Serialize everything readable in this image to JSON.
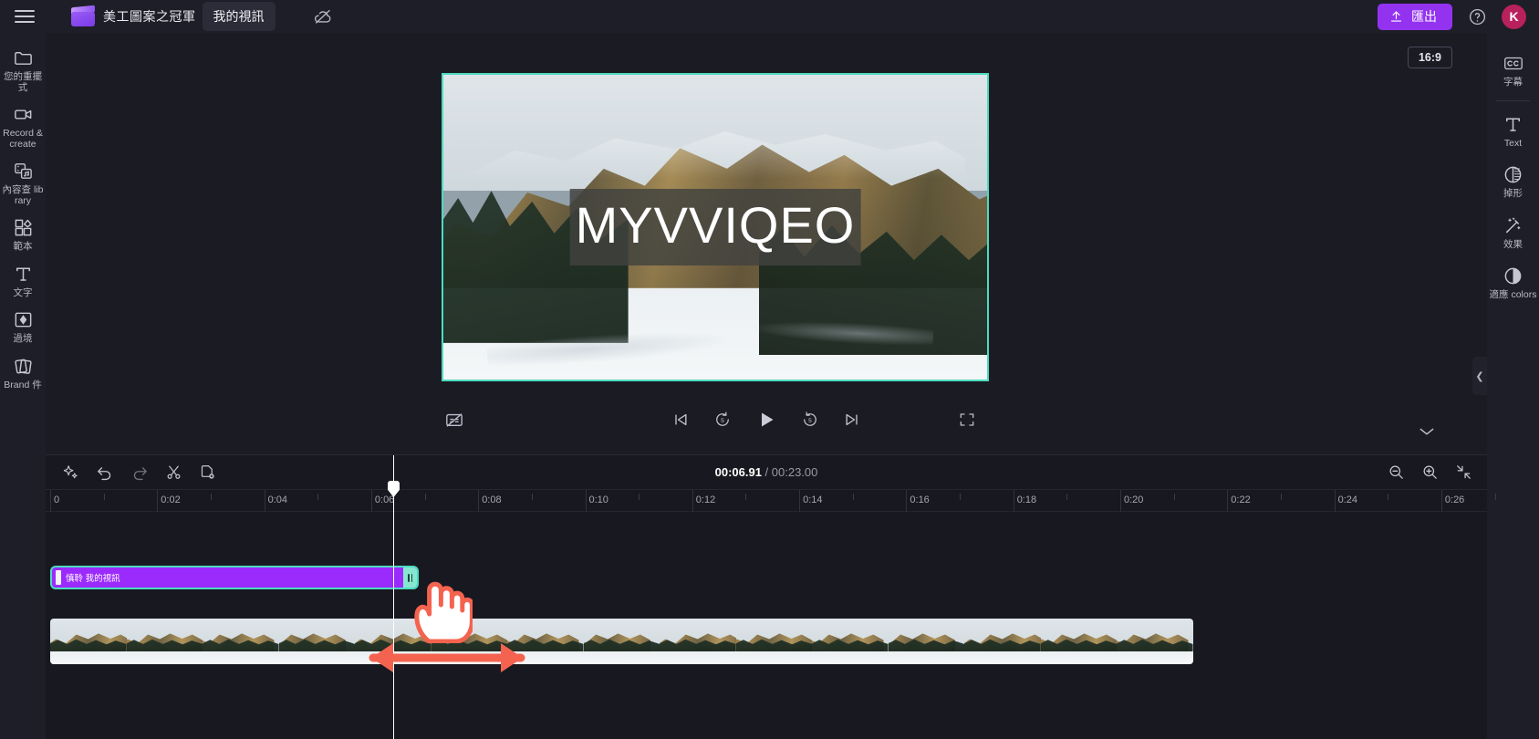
{
  "app": {
    "project_name": "美工圖案之冠軍",
    "title_value": "我的視訊",
    "hamburger_icon": "hamburger-menu-icon",
    "logo_icon": "clipchamp-logo-icon",
    "cloud_icon": "cloud-off-icon"
  },
  "topbar": {
    "export_label": "匯出",
    "export_icon": "upload-icon",
    "help_icon": "help-circle-icon",
    "avatar_initial": "K",
    "accent_color": "#9333f0",
    "avatar_color": "#b8215c"
  },
  "left_rail": {
    "items": [
      {
        "label": "您的重擺式",
        "icon": "folder-icon"
      },
      {
        "label": "Record & create",
        "icon": "video-camera-icon"
      },
      {
        "label": "內容查 library",
        "icon": "content-library-icon"
      },
      {
        "label": "範本",
        "icon": "templates-grid-icon"
      },
      {
        "label": "文字",
        "icon": "text-t-icon"
      },
      {
        "label": "過境",
        "icon": "transitions-icon"
      },
      {
        "label": "Brand 件",
        "icon": "brand-kit-icon"
      }
    ],
    "collapse_icon": "chevron-right-icon"
  },
  "right_rail": {
    "items": [
      {
        "label": "字幕",
        "icon": "closed-captions-icon"
      },
      {
        "label": "Text",
        "icon": "text-t-icon"
      },
      {
        "label": "掉形",
        "icon": "fade-filters-icon"
      },
      {
        "label": "效果",
        "icon": "magic-wand-effects-icon"
      },
      {
        "label": "適應 colors",
        "icon": "adjust-colors-icon"
      }
    ],
    "collapse_icon": "chevron-left-icon"
  },
  "preview": {
    "ratio_badge": "16:9",
    "overlay_text": "MYVVIQEO",
    "frame_border_color": "#4ddbc0",
    "chevron_down_icon": "chevron-down-icon",
    "controls": {
      "captions_icon": "captions-off-icon",
      "skip_start_icon": "skip-to-start-icon",
      "back5_icon": "rewind-5s-icon",
      "play_icon": "play-icon",
      "fwd5_icon": "forward-5s-icon",
      "skip_end_icon": "skip-to-end-icon",
      "fullscreen_icon": "fullscreen-icon"
    }
  },
  "timeline": {
    "tools": [
      {
        "icon": "magic-sparkle-icon",
        "name": "auto-compose-tool"
      },
      {
        "icon": "undo-icon",
        "name": "undo-tool"
      },
      {
        "icon": "redo-icon",
        "name": "redo-tool"
      },
      {
        "icon": "scissors-split-icon",
        "name": "split-tool"
      },
      {
        "icon": "duplicate-icon",
        "name": "duplicate-tool"
      }
    ],
    "current_time": "00:06.91",
    "time_separator": " / ",
    "total_time": "00:23.00",
    "zoom_controls": [
      {
        "icon": "zoom-out-icon",
        "name": "zoom-out-button"
      },
      {
        "icon": "zoom-in-icon",
        "name": "zoom-in-button"
      },
      {
        "icon": "fit-timeline-icon",
        "name": "fit-to-timeline-button"
      }
    ],
    "ruler_labels": [
      "0",
      "0:02",
      "0:04",
      "0:06",
      "0:08",
      "0:10",
      "0:12",
      "0:14",
      "0:16",
      "0:18",
      "0:20",
      "0:22",
      "0:24",
      "0:26"
    ],
    "text_clip": {
      "label": "慎聆 我的視訊",
      "color": "#9b2bfd",
      "selected_border": "#4ddbc0"
    },
    "video_clip": {
      "thumbnail_count": 15
    },
    "playhead_position_label": "0:06"
  },
  "annotation": {
    "cursor_icon": "pointing-hand-cursor",
    "arrow_icon": "double-headed-arrow",
    "arrow_color": "#f4634f"
  }
}
